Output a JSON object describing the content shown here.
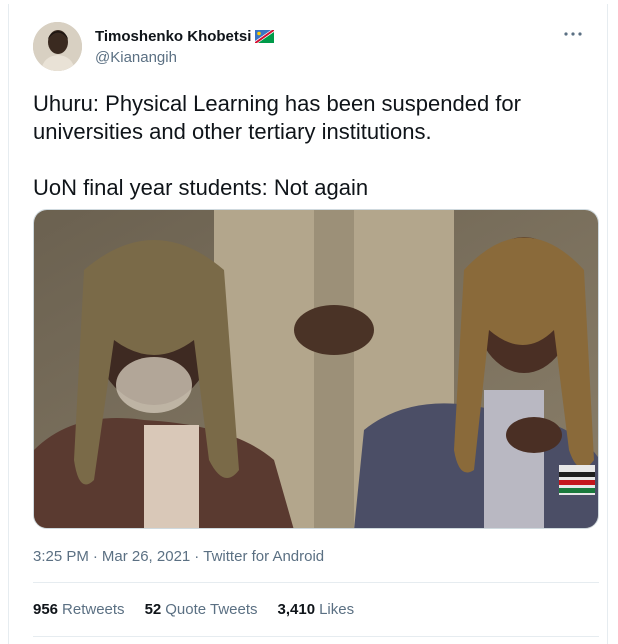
{
  "author": {
    "display_name": "Timoshenko Khobetsi",
    "handle": "@Kianangih",
    "flag_icon": "namibia-flag-icon"
  },
  "tweet": {
    "text": "Uhuru: Physical Learning has been suspended for\nuniversities and other tertiary institutions.\n\nUoN final year students: Not again"
  },
  "meta": {
    "time": "3:25 PM",
    "separator": "·",
    "date": "Mar 26, 2021",
    "client": "Twitter for Android"
  },
  "stats": {
    "retweets_count": "956",
    "retweets_label": "Retweets",
    "quotes_count": "52",
    "quotes_label": "Quote Tweets",
    "likes_count": "3,410",
    "likes_label": "Likes"
  },
  "colors": {
    "secondary_text": "#5b7083",
    "primary_text": "#0f1419",
    "divider": "#e6ecf0"
  }
}
